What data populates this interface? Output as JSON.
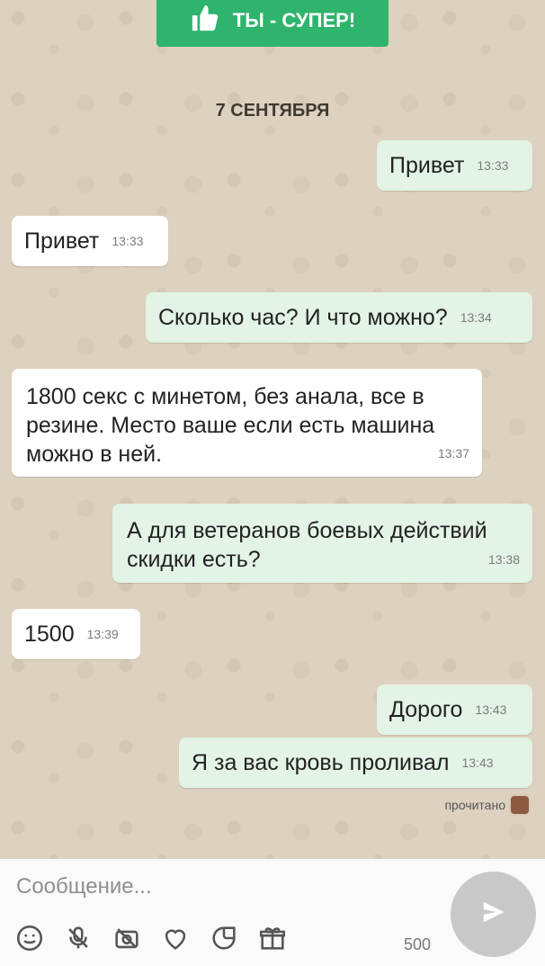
{
  "top_button": {
    "label": "ТЫ - СУПЕР!"
  },
  "date_chip": "7 СЕНТЯБРЯ",
  "messages": [
    {
      "text": "Привет",
      "time": "13:33"
    },
    {
      "text": "Привет",
      "time": "13:33"
    },
    {
      "text": "Сколько час? И что можно?",
      "time": "13:34"
    },
    {
      "text": "1800 секс с минетом, без анала, все в резине. Место ваше если есть машина можно в ней.",
      "time": "13:37"
    },
    {
      "text": "А для ветеранов боевых действий скидки есть?",
      "time": "13:38"
    },
    {
      "text": "1500",
      "time": "13:39"
    },
    {
      "text": "Дорого",
      "time": "13:43"
    },
    {
      "text": "Я за вас кровь проливал",
      "time": "13:43"
    }
  ],
  "read_status": "прочитано",
  "composer": {
    "placeholder": "Сообщение...",
    "counter": "500"
  },
  "icons": [
    "smiley-icon",
    "mic-off-icon",
    "camera-off-icon",
    "heart-icon",
    "sticker-icon",
    "gift-icon",
    "send-icon",
    "thumbs-up-icon"
  ]
}
